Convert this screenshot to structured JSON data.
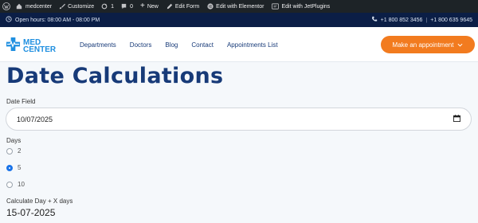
{
  "adminbar": {
    "site_name": "medcenter",
    "customize": "Customize",
    "updates_count": "1",
    "comments_count": "0",
    "new_label": "New",
    "edit_form": "Edit Form",
    "edit_elementor": "Edit with Elementor",
    "edit_jet": "Edit with JetPlugins"
  },
  "topbar": {
    "hours": "Open hours: 08:00 AM - 08:00 PM",
    "phone1": "+1 800 852 3456",
    "separator": "|",
    "phone2": "+1 800 635 9645"
  },
  "header": {
    "logo_line1": "MED",
    "logo_line2": "CENTER",
    "nav": [
      "Departments",
      "Doctors",
      "Blog",
      "Contact",
      "Appointments List"
    ],
    "cta_label": "Make an appointment"
  },
  "main": {
    "title": "Date Calculations",
    "date_field_label": "Date Field",
    "date_value": "10/07/2025",
    "days_label": "Days",
    "day_options": [
      {
        "label": "2",
        "checked": false
      },
      {
        "label": "5",
        "checked": true
      },
      {
        "label": "10",
        "checked": false
      }
    ],
    "calc_label": "Calculate Day + X days",
    "calc_result": "15-07-2025"
  },
  "colors": {
    "adminbar_bg": "#1d2327",
    "topbar_bg": "#0b1e46",
    "brand_blue": "#173a78",
    "cta_orange": "#f27b1f",
    "radio_checked": "#1a73e8"
  }
}
